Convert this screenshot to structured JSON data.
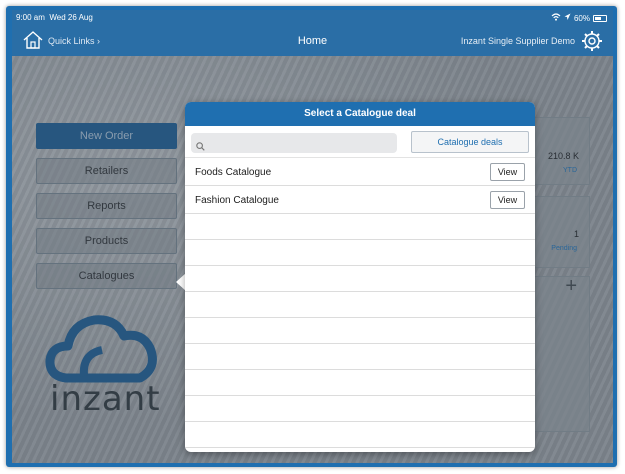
{
  "status_bar": {
    "time": "9:00 am",
    "date": "Wed 26 Aug",
    "battery": "60%"
  },
  "nav": {
    "quick_links": "Quick Links ›",
    "title": "Home",
    "supplier": "Inzant Single Supplier Demo"
  },
  "menu": {
    "items": [
      "New Order",
      "Retailers",
      "Reports",
      "Products",
      "Catalogues"
    ]
  },
  "logo": {
    "text": "inzant"
  },
  "tiles": {
    "ytd_value": "210.8 K",
    "ytd_label": "YTD",
    "pending_value": "1",
    "pending_label": "Pending"
  },
  "popover": {
    "title": "Select a Catalogue deal",
    "search_placeholder": "",
    "deals_button": "Catalogue deals",
    "catalogues": [
      {
        "name": "Foods Catalogue",
        "action": "View"
      },
      {
        "name": "Fashion Catalogue",
        "action": "View"
      }
    ]
  },
  "colors": {
    "brand": "#1f6fb0",
    "nav": "#2a6ea6",
    "primary_button": "#1c5a8e"
  }
}
